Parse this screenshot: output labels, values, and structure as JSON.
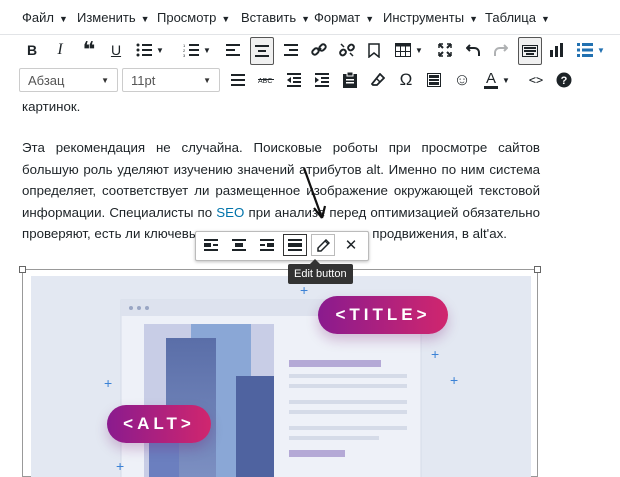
{
  "menu": {
    "items": [
      {
        "label": "Файл"
      },
      {
        "label": "Изменить"
      },
      {
        "label": "Просмотр"
      },
      {
        "label": "Вставить"
      },
      {
        "label": "Формат"
      },
      {
        "label": "Инструменты"
      },
      {
        "label": "Таблица"
      }
    ]
  },
  "toolbar2": {
    "format_select": "Абзац",
    "size_select": "11pt",
    "special_char": "Ω"
  },
  "content": {
    "line0": "картинок.",
    "para_a": "Эта рекомендация не случайна. Поисковые роботы при просмотре сайтов большую роль уделяют изучению значений атрибутов alt. Именно по ним система определяет, соответствует ли размещенное изображение окружающей текстовой информации. Специалисты по ",
    "para_link": "SEO",
    "para_b": " при анализе перед оптимизацией обязательно проверяют, есть ли ключевые слова, используемые для продвижения, в alt'ах."
  },
  "image_toolbar": {
    "tooltip": "Edit button"
  },
  "illustration": {
    "title_badge": "<TITLE>",
    "alt_badge": "<ALT>"
  },
  "colors": {
    "link": "#0073aa",
    "badge_gradient_start": "#8a1b8e",
    "badge_gradient_end": "#d0266e",
    "accent_blue": "#2271b1"
  }
}
